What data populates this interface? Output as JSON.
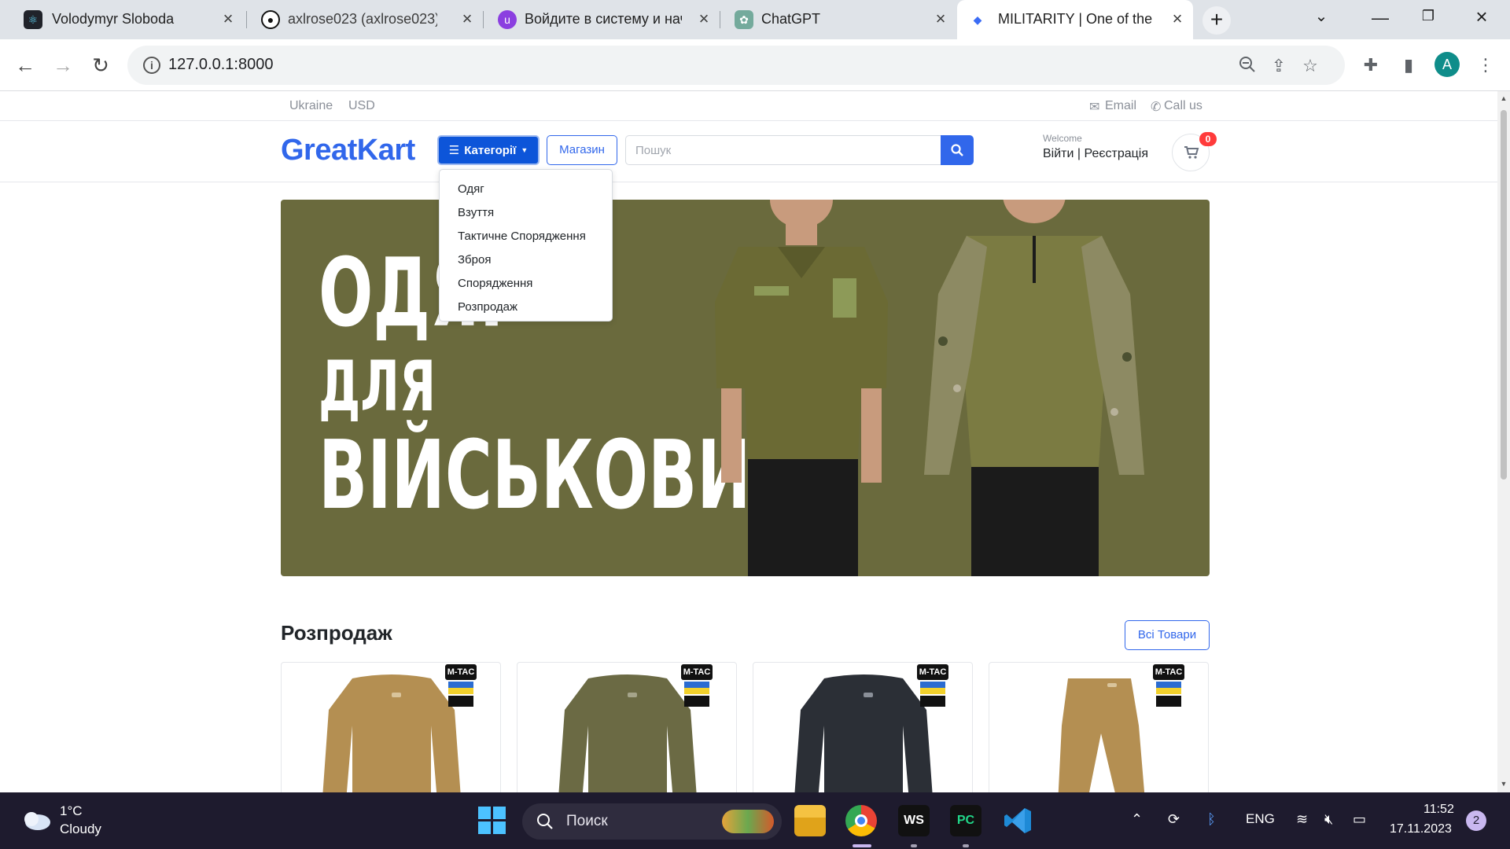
{
  "browser": {
    "tabs": [
      {
        "title": "Volodymyr Sloboda",
        "icon": "react-icon",
        "color": "#20232a"
      },
      {
        "title": "axlrose023 (axlrose023) / ",
        "icon": "github-icon",
        "color": "#ffffff"
      },
      {
        "title": "Войдите в систему и начн",
        "icon": "u-app-icon",
        "color": "#8b3fe0"
      },
      {
        "title": "ChatGPT",
        "icon": "chatgpt-icon",
        "color": "#74aa9c"
      },
      {
        "title": "MILITARITY | One of the Bes",
        "icon": "diamond-icon",
        "color": "#3b6cf5",
        "active": true
      }
    ],
    "new_tab": "+",
    "url": "127.0.0.1:8000",
    "profile_initial": "A"
  },
  "site": {
    "topstrip": {
      "region": "Ukraine",
      "currency": "USD",
      "email": "Email",
      "call": "Call us"
    },
    "logo_great": "Great",
    "logo_kart": "Kart",
    "categories_button": "Категорії",
    "shop_button": "Магазин",
    "search_placeholder": "Пошук",
    "welcome": "Welcome",
    "login": "Війти",
    "register": "Реєстрація",
    "cart_count": "0",
    "dropdown": [
      "Одяг",
      "Взуття",
      "Тактичне Спорядження",
      "Зброя",
      "Спорядження",
      "Розпродаж"
    ],
    "banner": {
      "line1": "ОДЯГ",
      "line2": "ДЛЯ",
      "line3": "ВІЙСЬКОВИХ",
      "bg": "#6a6a3d"
    },
    "sale_title": "Розпродаж",
    "all_products": "Всі Товари",
    "products": [
      {
        "color": "#b48f52",
        "kind": "shirt",
        "badge": "M-TAC"
      },
      {
        "color": "#6b6a44",
        "kind": "shirt",
        "badge": "M-TAC"
      },
      {
        "color": "#2b2f36",
        "kind": "shirt",
        "badge": "M-TAC"
      },
      {
        "color": "#b48f52",
        "kind": "pants",
        "badge": "M-TAC"
      }
    ]
  },
  "taskbar": {
    "temp": "1°C",
    "weather": "Cloudy",
    "search": "Поиск",
    "lang": "ENG",
    "time": "11:52",
    "date": "17.11.2023",
    "notifications": "2"
  }
}
